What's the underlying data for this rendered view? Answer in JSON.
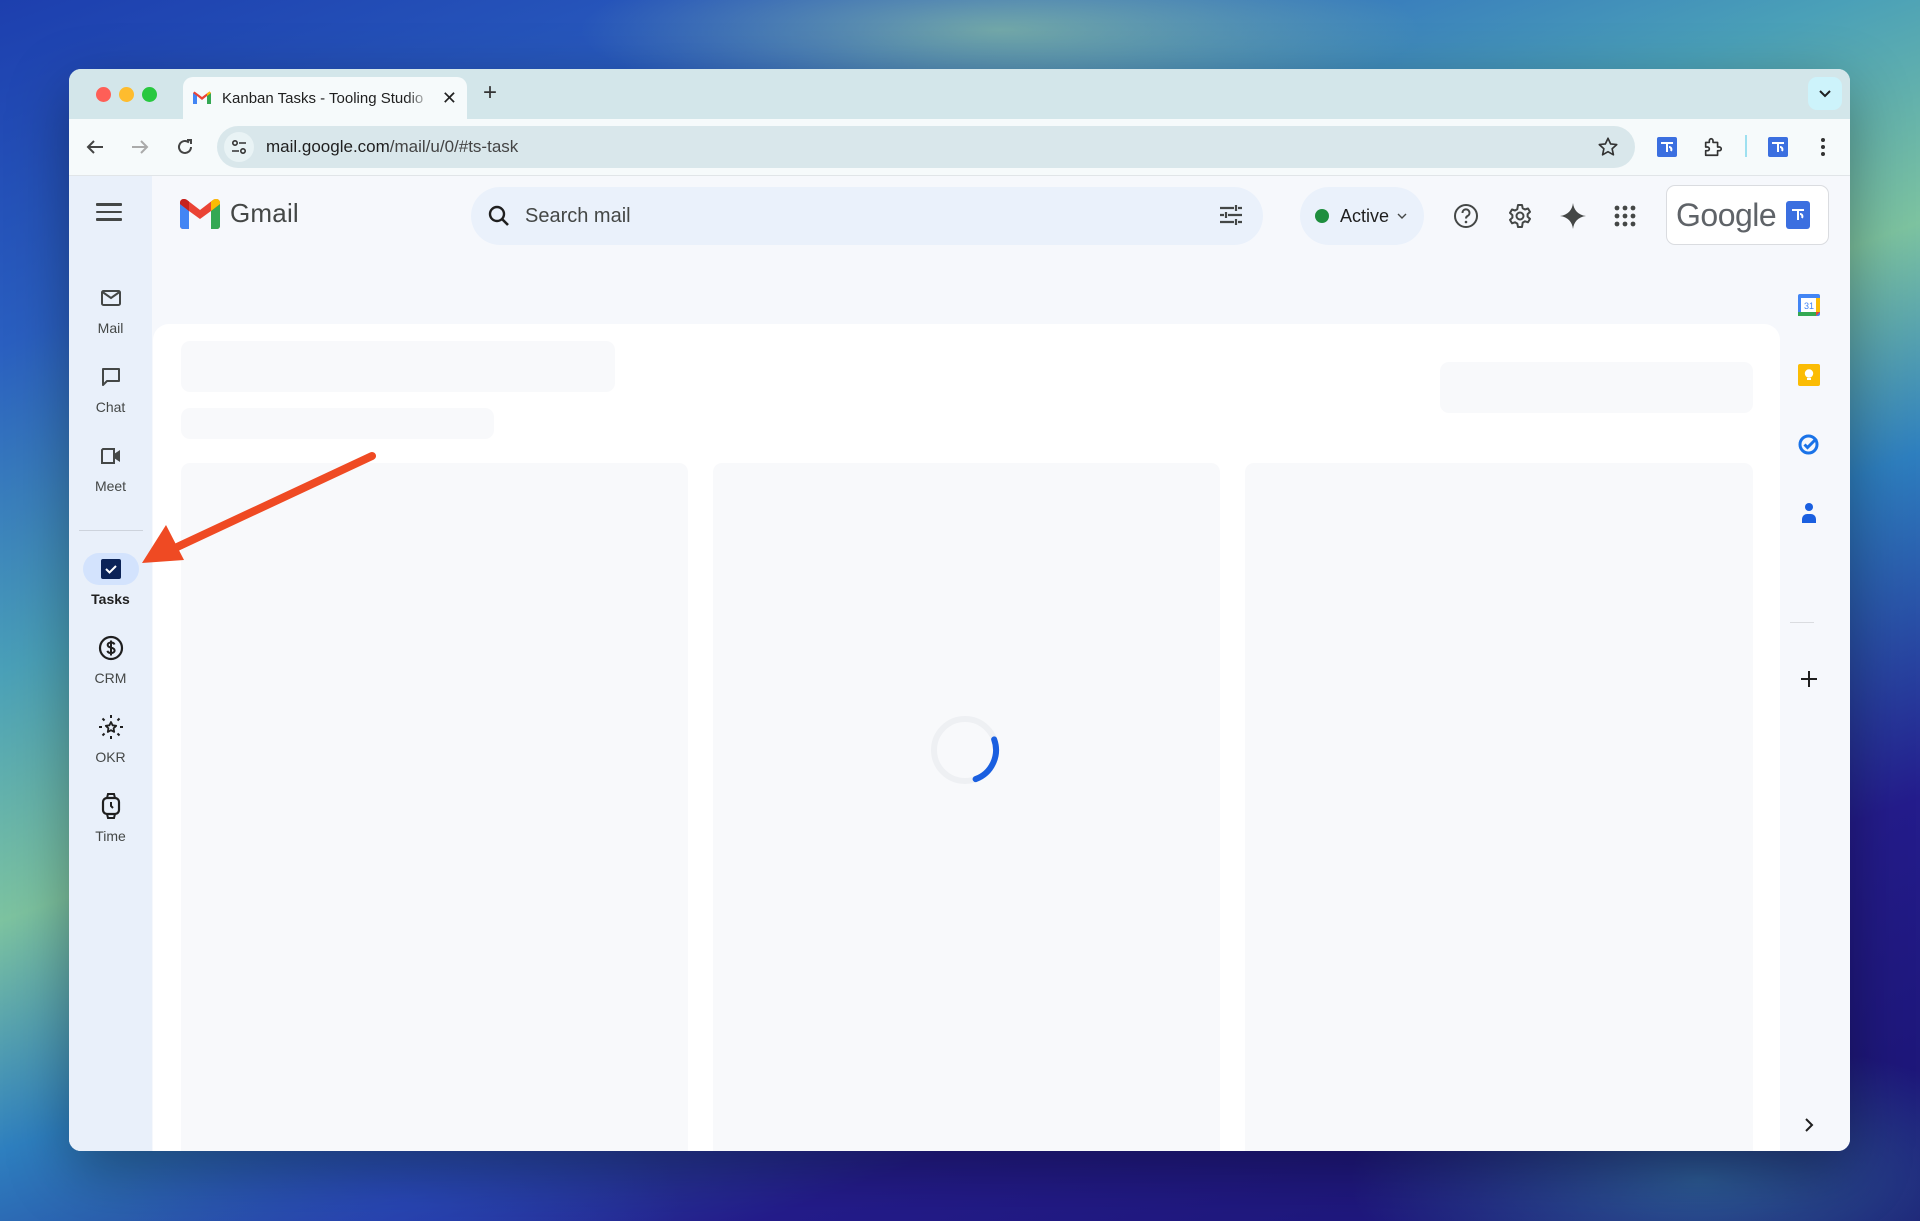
{
  "browser": {
    "tab": {
      "title": "Kanban Tasks - Tooling Studio",
      "favicon": "gmail-icon"
    },
    "new_tab_label": "+",
    "url_host": "mail.google.com",
    "url_path": "/mail/u/0/#ts-task",
    "toolbar_icons": [
      "back-icon",
      "forward-icon",
      "reload-icon",
      "site-info-icon",
      "bookmark-star-icon",
      "tooling-studio-extension-icon",
      "extensions-puzzle-icon",
      "tooling-studio-profile-icon",
      "more-vert-icon"
    ]
  },
  "gmail": {
    "logo_text": "Gmail",
    "search": {
      "placeholder": "Search mail",
      "value": ""
    },
    "status": {
      "label": "Active",
      "color": "#1e8e3e"
    },
    "header_icons": [
      "help-icon",
      "settings-icon",
      "gemini-sparkle-icon",
      "apps-grid-icon"
    ],
    "account": {
      "label": "Google"
    },
    "rail": {
      "items": [
        {
          "label": "Mail",
          "icon": "mail-icon",
          "active": false
        },
        {
          "label": "Chat",
          "icon": "chat-icon",
          "active": false
        },
        {
          "label": "Meet",
          "icon": "meet-icon",
          "active": false
        },
        {
          "label": "Tasks",
          "icon": "tasks-checkbox-icon",
          "active": true
        },
        {
          "label": "CRM",
          "icon": "dollar-icon",
          "active": false
        },
        {
          "label": "OKR",
          "icon": "okr-star-icon",
          "active": false
        },
        {
          "label": "Time",
          "icon": "watch-icon",
          "active": false
        }
      ]
    },
    "side_panel": {
      "calendar_day": "31",
      "items": [
        "calendar-icon",
        "keep-icon",
        "tasks-icon",
        "contacts-icon",
        "add-addon-icon"
      ]
    },
    "content": {
      "state": "loading",
      "columns": 3
    }
  },
  "colors": {
    "accent_blue": "#1a5fe0",
    "annotation_arrow": "#ef4a23",
    "active_rail": "#d3e3fd"
  }
}
